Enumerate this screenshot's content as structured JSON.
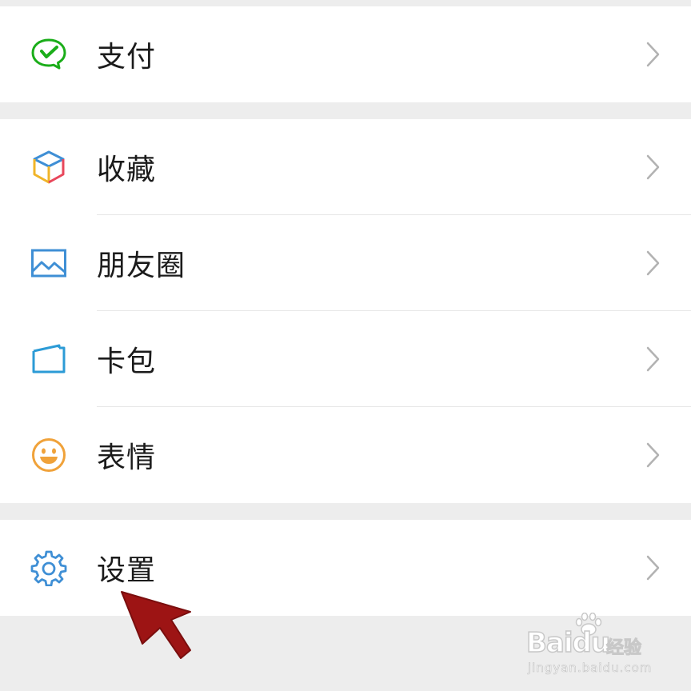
{
  "menu": {
    "groups": [
      {
        "items": [
          {
            "label": "支付",
            "icon": "wechat-pay-icon"
          }
        ]
      },
      {
        "items": [
          {
            "label": "收藏",
            "icon": "favorites-cube-icon"
          },
          {
            "label": "朋友圈",
            "icon": "moments-image-icon"
          },
          {
            "label": "卡包",
            "icon": "card-wallet-icon"
          },
          {
            "label": "表情",
            "icon": "smiley-icon"
          }
        ]
      },
      {
        "items": [
          {
            "label": "设置",
            "icon": "gear-icon"
          }
        ]
      }
    ]
  },
  "colors": {
    "background": "#ededed",
    "surface": "#ffffff",
    "pay_green": "#1aad19",
    "photo_blue": "#3f8fd5",
    "emoji_orange": "#f0a23a",
    "annotation_red": "#9d1414"
  },
  "watermark": {
    "brand": "Baidu",
    "product": "经验",
    "url": "jingyan.baidu.com"
  }
}
